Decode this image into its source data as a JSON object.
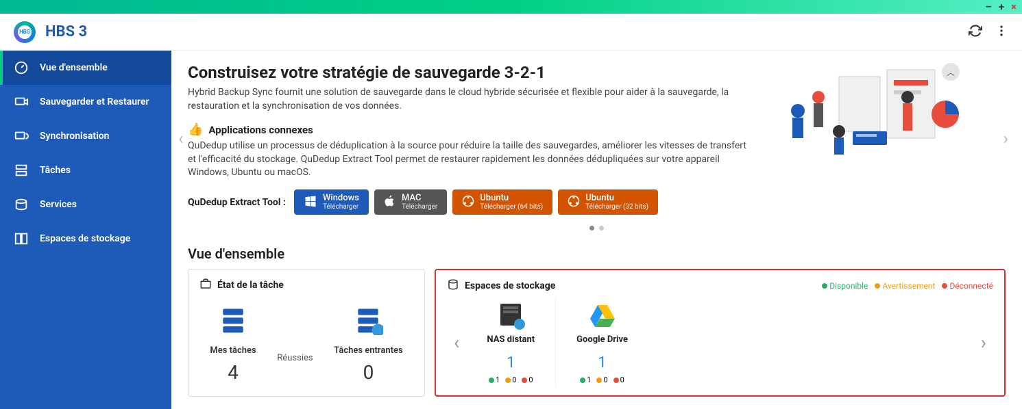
{
  "window": {
    "minimize": "–",
    "maximize": "+",
    "close": "×"
  },
  "header": {
    "title": "HBS 3"
  },
  "sidebar": {
    "items": [
      {
        "label": "Vue d'ensemble",
        "icon": "dashboard"
      },
      {
        "label": "Sauvegarder et Restaurer",
        "icon": "backup"
      },
      {
        "label": "Synchronisation",
        "icon": "sync"
      },
      {
        "label": "Tâches",
        "icon": "tasks"
      },
      {
        "label": "Services",
        "icon": "services"
      },
      {
        "label": "Espaces de stockage",
        "icon": "storage"
      }
    ]
  },
  "hero": {
    "title": "Construisez votre stratégie de sauvegarde 3-2-1",
    "desc": "Hybrid Backup Sync fournit une solution de sauvegarde dans le cloud hybride sécurisée et flexible pour aider à la sauvegarde, la restauration et la synchronisation de vos données.",
    "related_title": "Applications connexes",
    "related_desc": "QuDedup utilise un processus de déduplication à la source pour réduire la taille des sauvegardes, améliorer les vitesses de transfert et l'efficacité du stockage. QuDedup Extract Tool permet de restaurer rapidement les données dédupliquées sur votre appareil Windows, Ubuntu ou macOS.",
    "tool_label": "QuDedup Extract Tool :",
    "downloads": [
      {
        "os": "Windows",
        "sub": "Télécharger"
      },
      {
        "os": "MAC",
        "sub": "Télécharger"
      },
      {
        "os": "Ubuntu",
        "sub": "Télécharger (64 bits)"
      },
      {
        "os": "Ubuntu",
        "sub": "Télécharger (32 bits)"
      }
    ]
  },
  "overview": {
    "title": "Vue d'ensemble",
    "task_status": {
      "title": "État de la tâche",
      "my_tasks_label": "Mes tâches",
      "my_tasks_count": "4",
      "success_label": "Réussies",
      "incoming_label": "Tâches entrantes",
      "incoming_count": "0"
    },
    "storage": {
      "title": "Espaces de stockage",
      "legend": {
        "available": "Disponible",
        "warning": "Avertissement",
        "disconnected": "Déconnecté"
      },
      "items": [
        {
          "name": "NAS distant",
          "count": "1",
          "green": "1",
          "orange": "0",
          "red": "0"
        },
        {
          "name": "Google Drive",
          "count": "1",
          "green": "1",
          "orange": "0",
          "red": "0"
        }
      ]
    }
  }
}
